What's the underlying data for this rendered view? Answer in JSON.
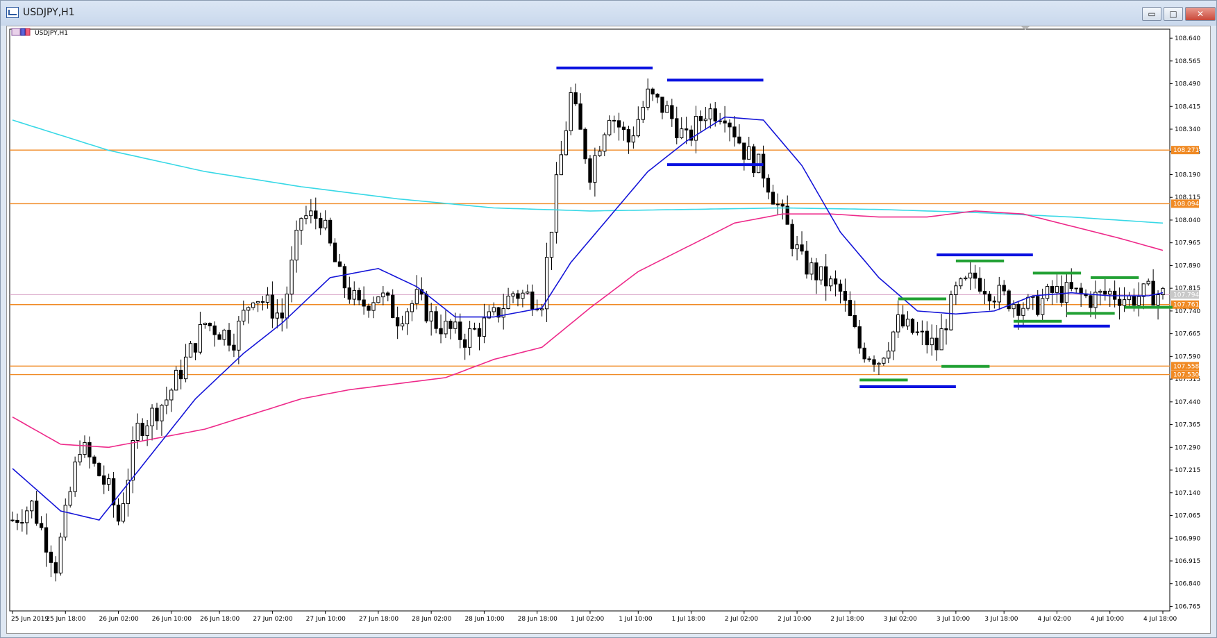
{
  "window": {
    "title": "USDJPY,H1",
    "symbol_label": "USDJPY,H1",
    "minimize": "▭",
    "maximize": "□",
    "close": "✕"
  },
  "colors": {
    "ema_fast": "#1515d8",
    "ema_mid": "#ee2a8a",
    "ema_slow": "#38d8e6",
    "hline": "#f08a24",
    "resistance_bar": "#0a12e0",
    "support_bar": "#21a033",
    "bid_line": "#d9a4c8"
  },
  "chart_data": {
    "type": "candlestick",
    "symbol": "USDJPY",
    "timeframe": "H1",
    "ylim": [
      106.75,
      108.67
    ],
    "x_ticks": [
      "25 Jun 2019",
      "25 Jun 18:00",
      "26 Jun 02:00",
      "26 Jun 10:00",
      "26 Jun 18:00",
      "27 Jun 02:00",
      "27 Jun 10:00",
      "27 Jun 18:00",
      "28 Jun 02:00",
      "28 Jun 10:00",
      "28 Jun 18:00",
      "1 Jul 02:00",
      "1 Jul 10:00",
      "1 Jul 18:00",
      "2 Jul 02:00",
      "2 Jul 10:00",
      "2 Jul 18:00",
      "3 Jul 02:00",
      "3 Jul 10:00",
      "3 Jul 18:00",
      "4 Jul 02:00",
      "4 Jul 10:00",
      "4 Jul 18:00"
    ],
    "y_ticks": [
      "108.640",
      "108.565",
      "108.490",
      "108.415",
      "108.340",
      "108.265",
      "108.190",
      "108.115",
      "108.040",
      "107.965",
      "107.890",
      "107.815",
      "107.740",
      "107.665",
      "107.590",
      "107.515",
      "107.440",
      "107.365",
      "107.290",
      "107.215",
      "107.140",
      "107.065",
      "106.990",
      "106.915",
      "106.840",
      "106.765"
    ],
    "horizontal_levels": [
      {
        "label": "108.271",
        "value": 108.271
      },
      {
        "label": "108.094",
        "value": 108.094
      },
      {
        "label": "107.761",
        "value": 107.761
      },
      {
        "label": "107.558",
        "value": 107.558
      },
      {
        "label": "107.530",
        "value": 107.53
      }
    ],
    "current_price_label": "107.794",
    "current_price": 107.794,
    "key_points": [
      [
        0,
        107.05
      ],
      [
        4,
        107.1
      ],
      [
        9,
        106.9
      ],
      [
        14,
        107.3
      ],
      [
        20,
        107.15
      ],
      [
        22,
        107.05
      ],
      [
        26,
        107.35
      ],
      [
        32,
        107.45
      ],
      [
        40,
        107.7
      ],
      [
        46,
        107.65
      ],
      [
        50,
        107.8
      ],
      [
        56,
        107.72
      ],
      [
        60,
        108.05
      ],
      [
        64,
        108.05
      ],
      [
        68,
        107.85
      ],
      [
        72,
        107.75
      ],
      [
        76,
        107.8
      ],
      [
        80,
        107.72
      ],
      [
        84,
        107.78
      ],
      [
        88,
        107.7
      ],
      [
        94,
        107.65
      ],
      [
        100,
        107.72
      ],
      [
        104,
        107.8
      ],
      [
        110,
        107.78
      ],
      [
        113,
        108.15
      ],
      [
        116,
        108.45
      ],
      [
        120,
        108.2
      ],
      [
        124,
        108.4
      ],
      [
        128,
        108.3
      ],
      [
        132,
        108.45
      ],
      [
        136,
        108.4
      ],
      [
        140,
        108.3
      ],
      [
        144,
        108.4
      ],
      [
        148,
        108.4
      ],
      [
        152,
        108.27
      ],
      [
        156,
        108.2
      ],
      [
        160,
        108.05
      ],
      [
        164,
        107.9
      ],
      [
        168,
        107.85
      ],
      [
        172,
        107.8
      ],
      [
        176,
        107.62
      ],
      [
        180,
        107.58
      ],
      [
        184,
        107.7
      ],
      [
        188,
        107.66
      ],
      [
        192,
        107.62
      ],
      [
        196,
        107.8
      ],
      [
        200,
        107.85
      ],
      [
        204,
        107.8
      ],
      [
        208,
        107.77
      ],
      [
        212,
        107.75
      ],
      [
        216,
        107.8
      ],
      [
        220,
        107.8
      ],
      [
        224,
        107.78
      ],
      [
        228,
        107.8
      ],
      [
        232,
        107.78
      ],
      [
        236,
        107.8
      ],
      [
        239,
        107.794
      ]
    ],
    "ema_fast_points": [
      [
        0,
        107.22
      ],
      [
        10,
        107.08
      ],
      [
        18,
        107.05
      ],
      [
        28,
        107.25
      ],
      [
        38,
        107.45
      ],
      [
        48,
        107.6
      ],
      [
        56,
        107.7
      ],
      [
        66,
        107.85
      ],
      [
        76,
        107.88
      ],
      [
        84,
        107.82
      ],
      [
        92,
        107.72
      ],
      [
        100,
        107.72
      ],
      [
        110,
        107.75
      ],
      [
        116,
        107.9
      ],
      [
        124,
        108.05
      ],
      [
        132,
        108.2
      ],
      [
        140,
        108.3
      ],
      [
        148,
        108.38
      ],
      [
        156,
        108.37
      ],
      [
        164,
        108.22
      ],
      [
        172,
        108.0
      ],
      [
        180,
        107.85
      ],
      [
        188,
        107.74
      ],
      [
        196,
        107.73
      ],
      [
        204,
        107.74
      ],
      [
        212,
        107.79
      ],
      [
        220,
        107.8
      ],
      [
        228,
        107.79
      ],
      [
        236,
        107.79
      ],
      [
        239,
        107.8
      ]
    ],
    "ema_mid_points": [
      [
        0,
        107.39
      ],
      [
        10,
        107.3
      ],
      [
        20,
        107.29
      ],
      [
        30,
        107.32
      ],
      [
        40,
        107.35
      ],
      [
        50,
        107.4
      ],
      [
        60,
        107.45
      ],
      [
        70,
        107.48
      ],
      [
        80,
        107.5
      ],
      [
        90,
        107.52
      ],
      [
        100,
        107.58
      ],
      [
        110,
        107.62
      ],
      [
        120,
        107.75
      ],
      [
        130,
        107.87
      ],
      [
        140,
        107.95
      ],
      [
        150,
        108.03
      ],
      [
        160,
        108.06
      ],
      [
        170,
        108.06
      ],
      [
        180,
        108.05
      ],
      [
        190,
        108.05
      ],
      [
        200,
        108.07
      ],
      [
        210,
        108.06
      ],
      [
        220,
        108.02
      ],
      [
        230,
        107.98
      ],
      [
        239,
        107.94
      ]
    ],
    "ema_slow_points": [
      [
        0,
        108.37
      ],
      [
        20,
        108.27
      ],
      [
        40,
        108.2
      ],
      [
        60,
        108.15
      ],
      [
        80,
        108.11
      ],
      [
        100,
        108.08
      ],
      [
        120,
        108.07
      ],
      [
        140,
        108.075
      ],
      [
        160,
        108.08
      ],
      [
        180,
        108.075
      ],
      [
        200,
        108.065
      ],
      [
        220,
        108.05
      ],
      [
        239,
        108.03
      ]
    ],
    "resistance_segments": [
      {
        "x1": 113,
        "x2": 133,
        "value": 108.542
      },
      {
        "x1": 136,
        "x2": 156,
        "value": 108.502
      },
      {
        "x1": 136,
        "x2": 156,
        "value": 108.223
      },
      {
        "x1": 192,
        "x2": 212,
        "value": 107.925
      },
      {
        "x1": 176,
        "x2": 196,
        "value": 107.49
      },
      {
        "x1": 208,
        "x2": 228,
        "value": 107.69
      }
    ],
    "support_segments": [
      {
        "x1": 176,
        "x2": 186,
        "value": 107.512
      },
      {
        "x1": 184,
        "x2": 194,
        "value": 107.78
      },
      {
        "x1": 193,
        "x2": 203,
        "value": 107.557
      },
      {
        "x1": 196,
        "x2": 206,
        "value": 107.905
      },
      {
        "x1": 208,
        "x2": 218,
        "value": 107.706
      },
      {
        "x1": 212,
        "x2": 222,
        "value": 107.865
      },
      {
        "x1": 219,
        "x2": 229,
        "value": 107.732
      },
      {
        "x1": 224,
        "x2": 234,
        "value": 107.85
      },
      {
        "x1": 231,
        "x2": 241,
        "value": 107.752
      }
    ]
  }
}
